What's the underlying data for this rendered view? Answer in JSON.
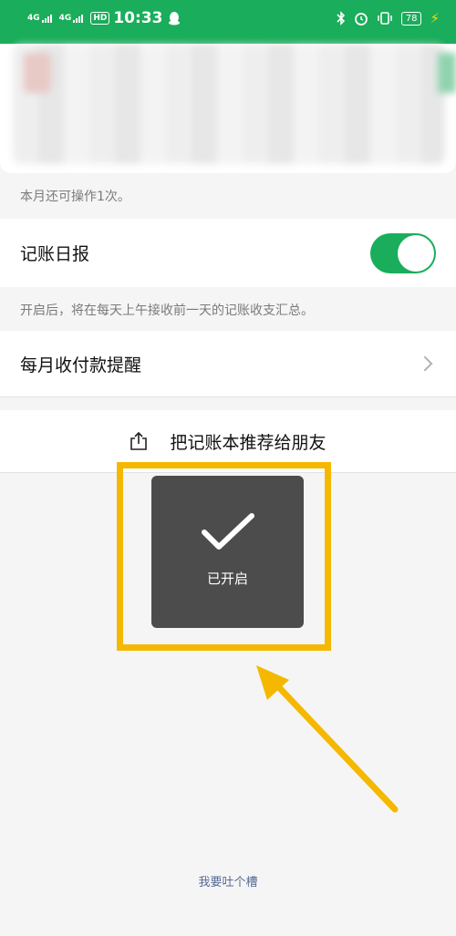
{
  "status_bar": {
    "signal_1": "4G",
    "signal_2": "4G",
    "hd_label": "HD",
    "time": "10:33",
    "battery": "78",
    "icons": [
      "qq-icon",
      "bluetooth-icon",
      "alarm-icon",
      "vibrate-icon",
      "battery-icon",
      "charging-icon"
    ]
  },
  "notice_text": "本月还可操作1次。",
  "daily_report": {
    "label": "记账日报",
    "enabled": true,
    "description": "开启后，将在每天上午接收前一天的记账收支汇总。"
  },
  "monthly_reminder": {
    "label": "每月收付款提醒"
  },
  "share": {
    "label": "把记账本推荐给朋友",
    "icon": "share-icon"
  },
  "toast": {
    "text": "已开启",
    "icon": "checkmark-icon"
  },
  "feedback_link": "我要吐个槽",
  "colors": {
    "brand_green": "#1aad5b",
    "highlight_yellow": "#f5b800",
    "toast_bg": "#4c4c4c",
    "link_blue": "#576b95"
  }
}
